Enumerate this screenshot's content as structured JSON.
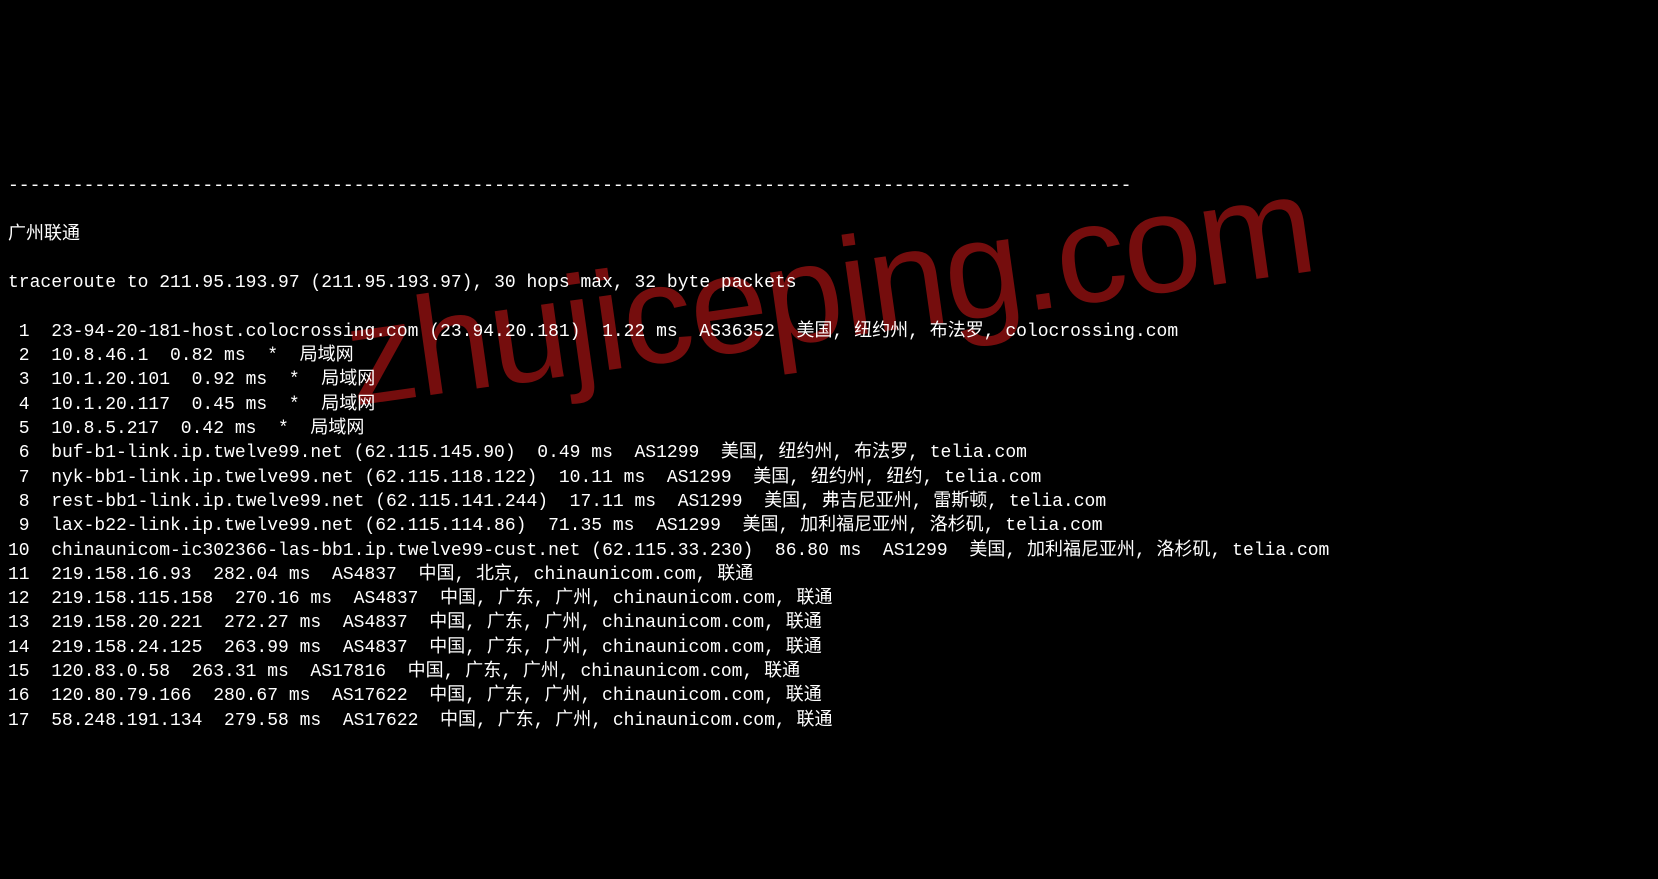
{
  "divider": "--------------------------------------------------------------------------------------------------------",
  "title": "广州联通",
  "header": "traceroute to 211.95.193.97 (211.95.193.97), 30 hops max, 32 byte packets",
  "hops": [
    {
      "num": "1",
      "text": "23-94-20-181-host.colocrossing.com (23.94.20.181)  1.22 ms  AS36352  美国, 纽约州, 布法罗, colocrossing.com"
    },
    {
      "num": "2",
      "text": "10.8.46.1  0.82 ms  *  局域网"
    },
    {
      "num": "3",
      "text": "10.1.20.101  0.92 ms  *  局域网"
    },
    {
      "num": "4",
      "text": "10.1.20.117  0.45 ms  *  局域网"
    },
    {
      "num": "5",
      "text": "10.8.5.217  0.42 ms  *  局域网"
    },
    {
      "num": "6",
      "text": "buf-b1-link.ip.twelve99.net (62.115.145.90)  0.49 ms  AS1299  美国, 纽约州, 布法罗, telia.com"
    },
    {
      "num": "7",
      "text": "nyk-bb1-link.ip.twelve99.net (62.115.118.122)  10.11 ms  AS1299  美国, 纽约州, 纽约, telia.com"
    },
    {
      "num": "8",
      "text": "rest-bb1-link.ip.twelve99.net (62.115.141.244)  17.11 ms  AS1299  美国, 弗吉尼亚州, 雷斯顿, telia.com"
    },
    {
      "num": "9",
      "text": "lax-b22-link.ip.twelve99.net (62.115.114.86)  71.35 ms  AS1299  美国, 加利福尼亚州, 洛杉矶, telia.com"
    },
    {
      "num": "10",
      "text": "chinaunicom-ic302366-las-bb1.ip.twelve99-cust.net (62.115.33.230)  86.80 ms  AS1299  美国, 加利福尼亚州, 洛杉矶, telia.com"
    },
    {
      "num": "11",
      "text": "219.158.16.93  282.04 ms  AS4837  中国, 北京, chinaunicom.com, 联通"
    },
    {
      "num": "12",
      "text": "219.158.115.158  270.16 ms  AS4837  中国, 广东, 广州, chinaunicom.com, 联通"
    },
    {
      "num": "13",
      "text": "219.158.20.221  272.27 ms  AS4837  中国, 广东, 广州, chinaunicom.com, 联通"
    },
    {
      "num": "14",
      "text": "219.158.24.125  263.99 ms  AS4837  中国, 广东, 广州, chinaunicom.com, 联通"
    },
    {
      "num": "15",
      "text": "120.83.0.58  263.31 ms  AS17816  中国, 广东, 广州, chinaunicom.com, 联通"
    },
    {
      "num": "16",
      "text": "120.80.79.166  280.67 ms  AS17622  中国, 广东, 广州, chinaunicom.com, 联通"
    },
    {
      "num": "17",
      "text": "58.248.191.134  279.58 ms  AS17622  中国, 广东, 广州, chinaunicom.com, 联通"
    }
  ],
  "watermark": "zhujiceping.com"
}
